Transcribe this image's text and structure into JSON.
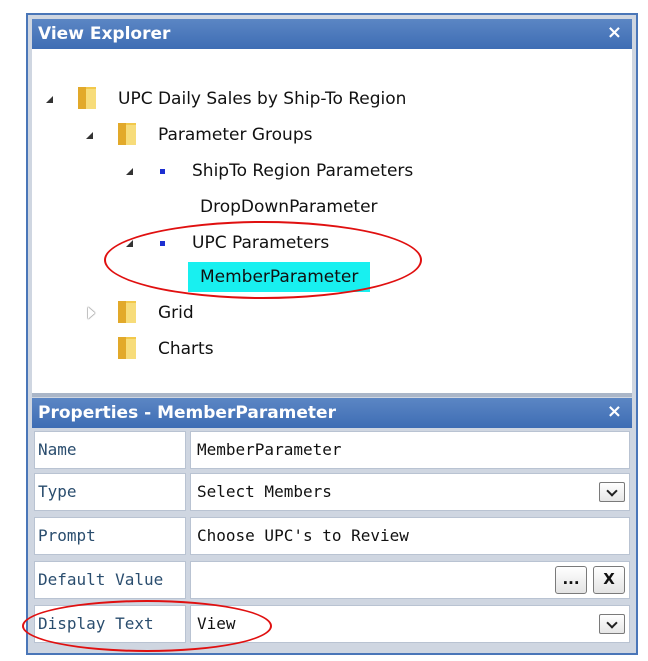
{
  "explorer": {
    "title": "View Explorer",
    "close_label": "×",
    "nodes": [
      {
        "label": "UPC Daily Sales by Ship-To Region"
      },
      {
        "label": "Parameter Groups"
      },
      {
        "label": "ShipTo Region Parameters"
      },
      {
        "label": "DropDownParameter"
      },
      {
        "label": "UPC Parameters"
      },
      {
        "label": "MemberParameter"
      },
      {
        "label": "Grid"
      },
      {
        "label": "Charts"
      }
    ]
  },
  "properties": {
    "title": "Properties - MemberParameter",
    "close_label": "×",
    "rows": [
      {
        "name": "Name",
        "value": "MemberParameter"
      },
      {
        "name": "Type",
        "value": "Select Members"
      },
      {
        "name": "Prompt",
        "value": "Choose UPC's to Review"
      },
      {
        "name": "Default Value",
        "value": "",
        "ellipsis_label": "...",
        "clear_label": "X"
      },
      {
        "name": "Display Text",
        "value": "View"
      }
    ]
  },
  "colors": {
    "header": "#3e6db4",
    "selection": "#18f0f0",
    "annotation": "#e01010",
    "bullet": "#1d2fd1"
  }
}
